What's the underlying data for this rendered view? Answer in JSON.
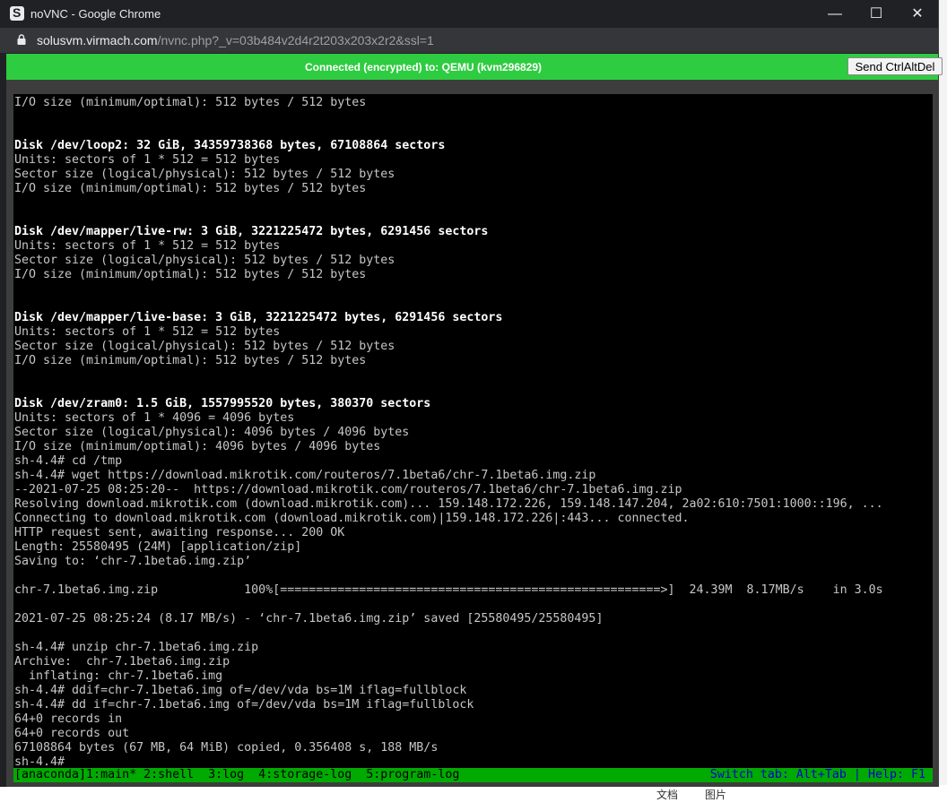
{
  "window": {
    "title": "noVNC - Google Chrome",
    "minimize": "—",
    "maximize": "☐",
    "close": "✕"
  },
  "address": {
    "host": "solusvm.virmach.com",
    "path": "/nvnc.php?_v=03b484v2d4r2t203x203x2r2&ssl=1"
  },
  "vnc": {
    "status": "Connected (encrypted) to: QEMU (kvm296829)",
    "send_cad_label": "Send CtrlAltDel"
  },
  "terminal": {
    "lines": [
      {
        "text": "I/O size (minimum/optimal): 512 bytes / 512 bytes",
        "bold": false
      },
      {
        "text": "",
        "bold": false
      },
      {
        "text": "",
        "bold": false
      },
      {
        "text": "Disk /dev/loop2: 32 GiB, 34359738368 bytes, 67108864 sectors",
        "bold": true
      },
      {
        "text": "Units: sectors of 1 * 512 = 512 bytes",
        "bold": false
      },
      {
        "text": "Sector size (logical/physical): 512 bytes / 512 bytes",
        "bold": false
      },
      {
        "text": "I/O size (minimum/optimal): 512 bytes / 512 bytes",
        "bold": false
      },
      {
        "text": "",
        "bold": false
      },
      {
        "text": "",
        "bold": false
      },
      {
        "text": "Disk /dev/mapper/live-rw: 3 GiB, 3221225472 bytes, 6291456 sectors",
        "bold": true
      },
      {
        "text": "Units: sectors of 1 * 512 = 512 bytes",
        "bold": false
      },
      {
        "text": "Sector size (logical/physical): 512 bytes / 512 bytes",
        "bold": false
      },
      {
        "text": "I/O size (minimum/optimal): 512 bytes / 512 bytes",
        "bold": false
      },
      {
        "text": "",
        "bold": false
      },
      {
        "text": "",
        "bold": false
      },
      {
        "text": "Disk /dev/mapper/live-base: 3 GiB, 3221225472 bytes, 6291456 sectors",
        "bold": true
      },
      {
        "text": "Units: sectors of 1 * 512 = 512 bytes",
        "bold": false
      },
      {
        "text": "Sector size (logical/physical): 512 bytes / 512 bytes",
        "bold": false
      },
      {
        "text": "I/O size (minimum/optimal): 512 bytes / 512 bytes",
        "bold": false
      },
      {
        "text": "",
        "bold": false
      },
      {
        "text": "",
        "bold": false
      },
      {
        "text": "Disk /dev/zram0: 1.5 GiB, 1557995520 bytes, 380370 sectors",
        "bold": true
      },
      {
        "text": "Units: sectors of 1 * 4096 = 4096 bytes",
        "bold": false
      },
      {
        "text": "Sector size (logical/physical): 4096 bytes / 4096 bytes",
        "bold": false
      },
      {
        "text": "I/O size (minimum/optimal): 4096 bytes / 4096 bytes",
        "bold": false
      },
      {
        "text": "sh-4.4# cd /tmp",
        "bold": false
      },
      {
        "text": "sh-4.4# wget https://download.mikrotik.com/routeros/7.1beta6/chr-7.1beta6.img.zip",
        "bold": false
      },
      {
        "text": "--2021-07-25 08:25:20--  https://download.mikrotik.com/routeros/7.1beta6/chr-7.1beta6.img.zip",
        "bold": false
      },
      {
        "text": "Resolving download.mikrotik.com (download.mikrotik.com)... 159.148.172.226, 159.148.147.204, 2a02:610:7501:1000::196, ...",
        "bold": false
      },
      {
        "text": "Connecting to download.mikrotik.com (download.mikrotik.com)|159.148.172.226|:443... connected.",
        "bold": false
      },
      {
        "text": "HTTP request sent, awaiting response... 200 OK",
        "bold": false
      },
      {
        "text": "Length: 25580495 (24M) [application/zip]",
        "bold": false
      },
      {
        "text": "Saving to: ‘chr-7.1beta6.img.zip’",
        "bold": false
      },
      {
        "text": "",
        "bold": false
      },
      {
        "text": "chr-7.1beta6.img.zip            100%[=====================================================>]  24.39M  8.17MB/s    in 3.0s",
        "bold": false
      },
      {
        "text": "",
        "bold": false
      },
      {
        "text": "2021-07-25 08:25:24 (8.17 MB/s) - ‘chr-7.1beta6.img.zip’ saved [25580495/25580495]",
        "bold": false
      },
      {
        "text": "",
        "bold": false
      },
      {
        "text": "sh-4.4# unzip chr-7.1beta6.img.zip",
        "bold": false
      },
      {
        "text": "Archive:  chr-7.1beta6.img.zip",
        "bold": false
      },
      {
        "text": "  inflating: chr-7.1beta6.img",
        "bold": false
      },
      {
        "text": "sh-4.4# ddif=chr-7.1beta6.img of=/dev/vda bs=1M iflag=fullblock",
        "bold": false
      },
      {
        "text": "sh-4.4# dd if=chr-7.1beta6.img of=/dev/vda bs=1M iflag=fullblock",
        "bold": false
      },
      {
        "text": "64+0 records in",
        "bold": false
      },
      {
        "text": "64+0 records out",
        "bold": false
      },
      {
        "text": "67108864 bytes (67 MB, 64 MiB) copied, 0.356408 s, 188 MB/s",
        "bold": false
      },
      {
        "text": "sh-4.4#",
        "bold": false
      }
    ]
  },
  "tmux": {
    "tabs": "[anaconda]1:main* 2:shell  3:log  4:storage-log  5:program-log",
    "help": "Switch tab: Alt+Tab | Help: F1"
  },
  "background": {
    "text1": "文档",
    "text2": "图片"
  }
}
